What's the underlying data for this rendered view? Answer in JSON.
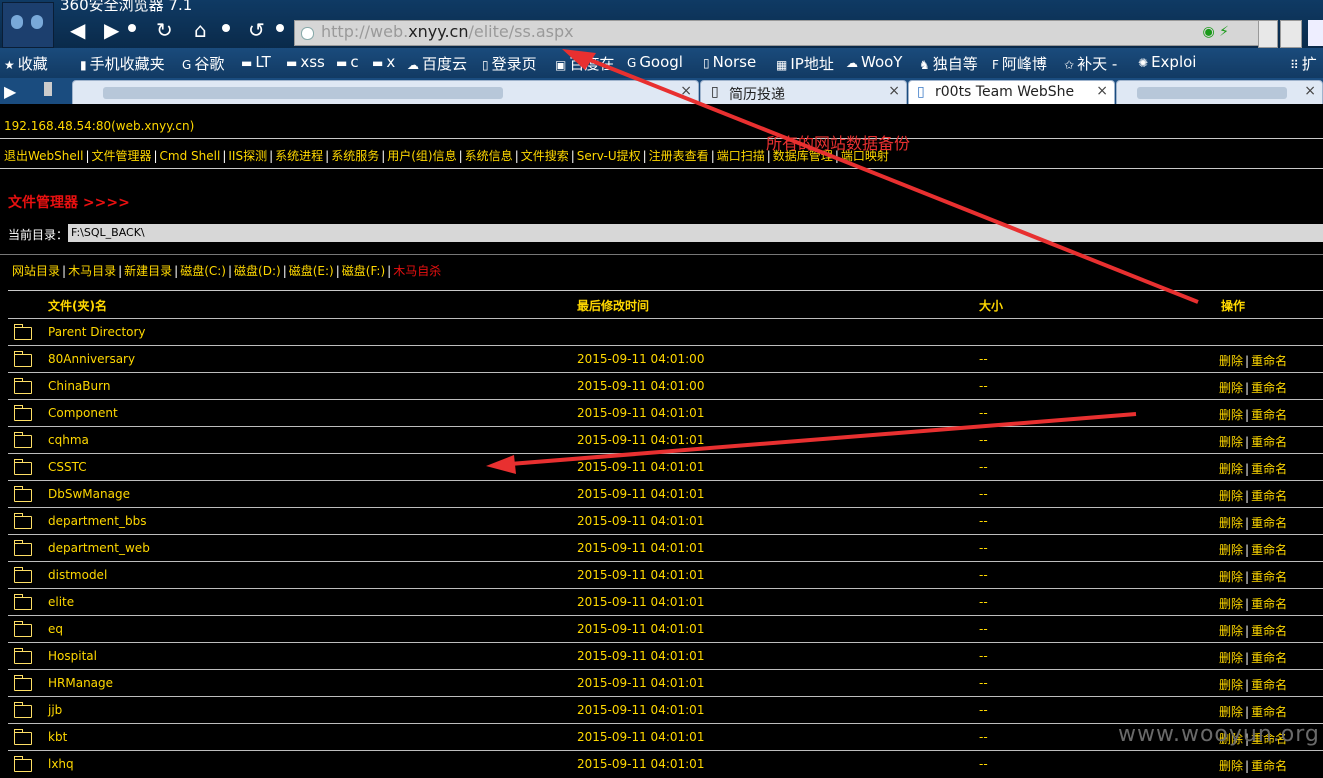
{
  "browser": {
    "title": "360安全浏览器 7.1",
    "url_prefix": "http://web.",
    "url_domain": "xnyy.cn",
    "url_path": "/elite/ss.aspx",
    "bookmarks": [
      "收藏",
      "手机收藏夹",
      "谷歌",
      "LT",
      "xss",
      "c",
      "x",
      "百度云",
      "登录页",
      "百度在",
      "Googl",
      "Norse",
      "IP地址",
      "WooY",
      "独自等",
      "阿峰博",
      "补天 -",
      "Exploi",
      "扩"
    ],
    "tabs": [
      {
        "label": ""
      },
      {
        "label": "简历投递"
      },
      {
        "label": "r00ts Team WebShe"
      },
      {
        "label": ""
      }
    ],
    "close_glyph": "×"
  },
  "page": {
    "host": "192.168.48.54:80(web.xnyy.cn)",
    "menu": [
      "退出WebShell",
      "文件管理器",
      "Cmd Shell",
      "IIS探测",
      "系统进程",
      "系统服务",
      "用户(组)信息",
      "系统信息",
      "文件搜索",
      "Serv-U提权",
      "注册表查看",
      "端口扫描",
      "数据库管理",
      "端口映射"
    ],
    "file_manager_title": "文件管理器 >>>>",
    "current_dir_label": "当前目录：",
    "current_dir": "F:\\SQL_BACK\\",
    "quick_links": [
      "网站目录",
      "木马目录",
      "新建目录",
      "磁盘(C:)",
      "磁盘(D:)",
      "磁盘(E:)",
      "磁盘(F:)"
    ],
    "quick_link_danger": "木马自杀",
    "annotation": "所有的网站数据备份",
    "table": {
      "headers": {
        "name": "文件(夹)名",
        "time": "最后修改时间",
        "size": "大小",
        "ops": "操作"
      },
      "op_delete": "删除",
      "op_rename": "重命名",
      "op_sep": "|",
      "rows": [
        {
          "name": "Parent Directory",
          "time": "",
          "size": "",
          "ops": false
        },
        {
          "name": "80Anniversary",
          "time": "2015-09-11 04:01:00",
          "size": "--",
          "ops": true
        },
        {
          "name": "ChinaBurn",
          "time": "2015-09-11 04:01:00",
          "size": "--",
          "ops": true
        },
        {
          "name": "Component",
          "time": "2015-09-11 04:01:01",
          "size": "--",
          "ops": true
        },
        {
          "name": "cqhma",
          "time": "2015-09-11 04:01:01",
          "size": "--",
          "ops": true
        },
        {
          "name": "CSSTC",
          "time": "2015-09-11 04:01:01",
          "size": "--",
          "ops": true
        },
        {
          "name": "DbSwManage",
          "time": "2015-09-11 04:01:01",
          "size": "--",
          "ops": true
        },
        {
          "name": "department_bbs",
          "time": "2015-09-11 04:01:01",
          "size": "--",
          "ops": true
        },
        {
          "name": "department_web",
          "time": "2015-09-11 04:01:01",
          "size": "--",
          "ops": true
        },
        {
          "name": "distmodel",
          "time": "2015-09-11 04:01:01",
          "size": "--",
          "ops": true
        },
        {
          "name": "elite",
          "time": "2015-09-11 04:01:01",
          "size": "--",
          "ops": true
        },
        {
          "name": "eq",
          "time": "2015-09-11 04:01:01",
          "size": "--",
          "ops": true
        },
        {
          "name": "Hospital",
          "time": "2015-09-11 04:01:01",
          "size": "--",
          "ops": true
        },
        {
          "name": "HRManage",
          "time": "2015-09-11 04:01:01",
          "size": "--",
          "ops": true
        },
        {
          "name": "jjb",
          "time": "2015-09-11 04:01:01",
          "size": "--",
          "ops": true
        },
        {
          "name": "kbt",
          "time": "2015-09-11 04:01:01",
          "size": "--",
          "ops": true
        },
        {
          "name": "lxhq",
          "time": "2015-09-11 04:01:01",
          "size": "--",
          "ops": true
        }
      ]
    },
    "watermark": "www.wooyun.org"
  },
  "colors": {
    "link": "#ffd800",
    "danger": "#e81010",
    "arrow": "#e83030",
    "background": "#000000"
  }
}
